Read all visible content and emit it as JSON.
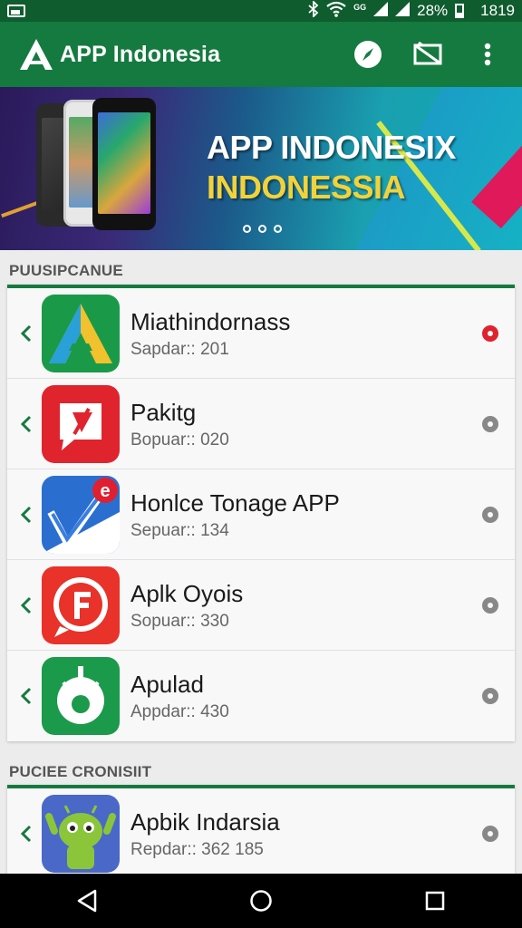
{
  "status_bar": {
    "signal_label": "GG",
    "battery_percent": "28%",
    "time": "1819"
  },
  "app_bar": {
    "title": "APP Indonesia",
    "icons": [
      "app-logo-icon",
      "compass-icon",
      "cast-icon",
      "more-vert-icon"
    ]
  },
  "banner": {
    "title": "APP INDONESIX",
    "subtitle": "INDONESSIA",
    "page_count": 3
  },
  "sections": [
    {
      "label": "PUUSIPCANUE",
      "apps": [
        {
          "name": "Miathindornass",
          "meta": "Sapdar:: 201",
          "active": true,
          "icon": "green-triangle-app-icon"
        },
        {
          "name": "Pakitg",
          "meta": "Bopuar:: 020",
          "active": false,
          "icon": "red-chat-app-icon"
        },
        {
          "name": "Honlce Tonage APP",
          "meta": "Sepuar:: 134",
          "active": false,
          "icon": "blue-check-app-icon"
        },
        {
          "name": "Aplk Oyois",
          "meta": "Sopuar:: 330",
          "active": false,
          "icon": "red-f-app-icon"
        },
        {
          "name": "Apulad",
          "meta": "Appdar:: 430",
          "active": false,
          "icon": "green-robot-app-icon"
        }
      ]
    },
    {
      "label": "PUCIEE CRONISIIT",
      "apps": [
        {
          "name": "Apbik Indarsia",
          "meta": "Repdar:: 362 185",
          "active": false,
          "icon": "android-mascot-app-icon"
        }
      ]
    }
  ],
  "colors": {
    "primary": "#157a3f",
    "status_bar": "#0f5c2e",
    "active_dot": "#e0222e",
    "inactive_dot": "#888888",
    "banner_accent": "#f2d23a"
  }
}
